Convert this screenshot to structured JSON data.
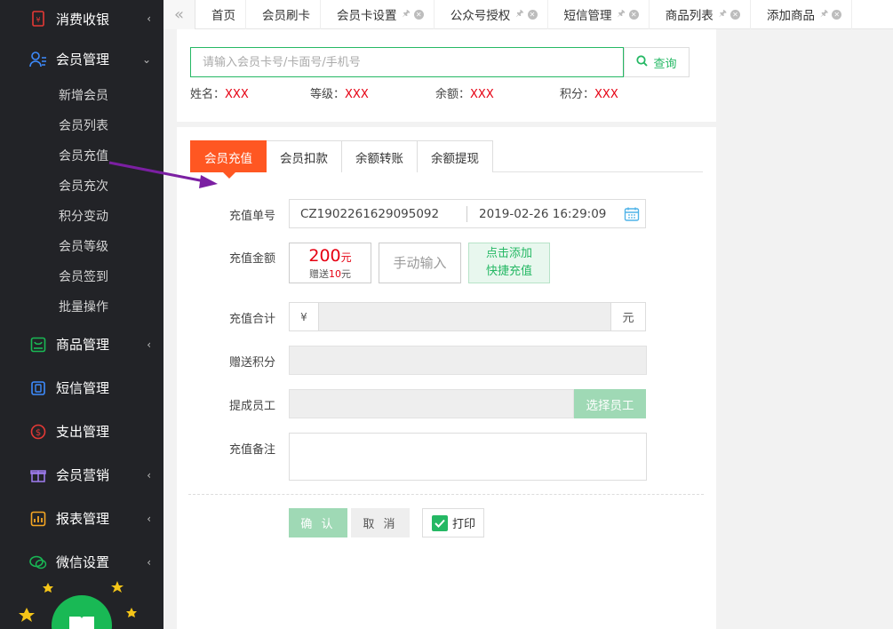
{
  "sidebar": {
    "groups": [
      {
        "label": "消费收银",
        "icon": "cashier-icon"
      },
      {
        "label": "会员管理",
        "icon": "member-icon"
      },
      {
        "label": "商品管理",
        "icon": "goods-icon"
      },
      {
        "label": "短信管理",
        "icon": "sms-icon"
      },
      {
        "label": "支出管理",
        "icon": "expense-icon"
      },
      {
        "label": "会员营销",
        "icon": "gift-icon"
      },
      {
        "label": "报表管理",
        "icon": "report-icon"
      },
      {
        "label": "微信设置",
        "icon": "wechat-icon"
      }
    ],
    "member_items": [
      "新增会员",
      "会员列表",
      "会员充值",
      "会员充次",
      "积分变动",
      "会员等级",
      "会员签到",
      "批量操作"
    ]
  },
  "tabs": [
    {
      "label": "首页"
    },
    {
      "label": "会员刷卡"
    },
    {
      "label": "会员卡设置"
    },
    {
      "label": "公众号授权"
    },
    {
      "label": "短信管理"
    },
    {
      "label": "商品列表"
    },
    {
      "label": "添加商品"
    }
  ],
  "search": {
    "placeholder": "请输入会员卡号/卡面号/手机号",
    "button": "查询"
  },
  "member_info": {
    "name_label": "姓名：",
    "name_value": "XXX",
    "level_label": "等级：",
    "level_value": "XXX",
    "balance_label": "余额：",
    "balance_value": "XXX",
    "points_label": "积分：",
    "points_value": "XXX"
  },
  "form_tabs": [
    "会员充值",
    "会员扣款",
    "余额转账",
    "余额提现"
  ],
  "form": {
    "order_label": "充值单号",
    "order_no": "CZ1902261629095092",
    "order_time": "2019-02-26 16:29:09",
    "amount_label": "充值金额",
    "preset_amount": "200",
    "preset_unit": "元",
    "gift_prefix": "赠送",
    "gift_amount": "10",
    "gift_unit": "元",
    "manual_input": "手动输入",
    "add_quick_line1": "点击添加",
    "add_quick_line2": "快捷充值",
    "total_label": "充值合计",
    "currency_symbol": "¥",
    "total_unit": "元",
    "points_label": "赠送积分",
    "staff_label": "提成员工",
    "staff_button": "选择员工",
    "remark_label": "充值备注",
    "confirm": "确 认",
    "cancel": "取 消",
    "print": "打印"
  },
  "colors": {
    "accent_green": "#25b864",
    "active_tab_orange": "#ff5722",
    "value_red": "#e60012",
    "sidebar_bg": "#222327",
    "annotation_arrow": "#7b1fa2"
  }
}
